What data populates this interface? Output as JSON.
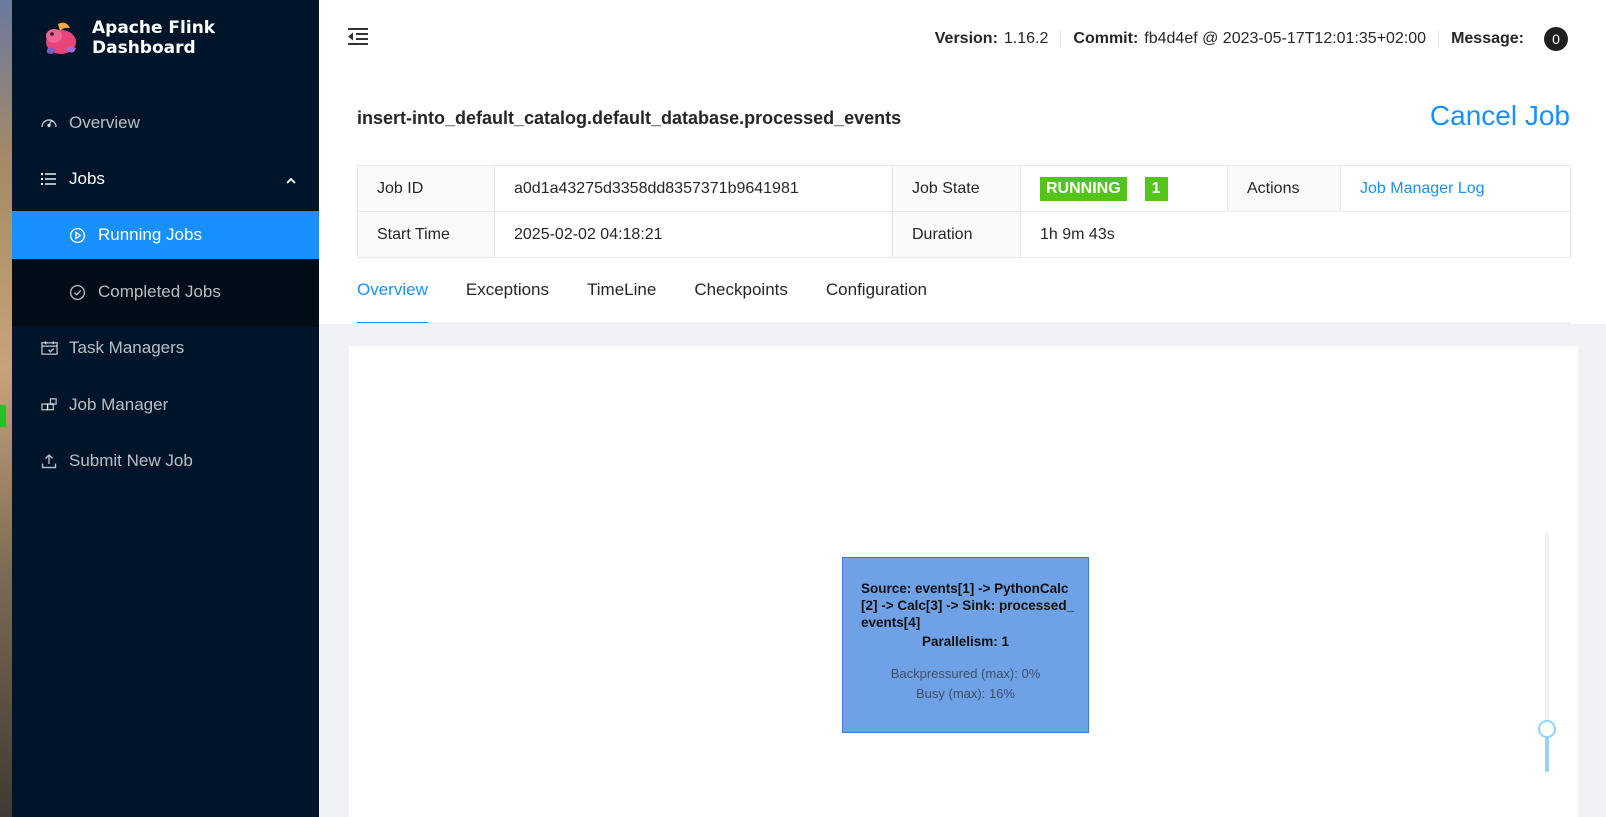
{
  "app": {
    "title": "Apache Flink Dashboard"
  },
  "sidebar": {
    "items": [
      {
        "label": "Overview",
        "icon": "dashboard-icon"
      },
      {
        "label": "Jobs",
        "icon": "list-icon"
      },
      {
        "label": "Running Jobs",
        "icon": "play-circle-icon"
      },
      {
        "label": "Completed Jobs",
        "icon": "check-circle-icon"
      },
      {
        "label": "Task Managers",
        "icon": "schedule-icon"
      },
      {
        "label": "Job Manager",
        "icon": "build-icon"
      },
      {
        "label": "Submit New Job",
        "icon": "upload-icon"
      }
    ]
  },
  "header": {
    "version_label": "Version:",
    "version": "1.16.2",
    "commit_label": "Commit:",
    "commit": "fb4d4ef @ 2023-05-17T12:01:35+02:00",
    "message_label": "Message:",
    "message_count": "0"
  },
  "job": {
    "name": "insert-into_default_catalog.default_database.processed_events",
    "cancel_label": "Cancel Job",
    "id_label": "Job ID",
    "id": "a0d1a43275d3358dd8357371b9641981",
    "state_label": "Job State",
    "state": "RUNNING",
    "state_count": "1",
    "actions_label": "Actions",
    "jm_log_label": "Job Manager Log",
    "start_label": "Start Time",
    "start": "2025-02-02 04:18:21",
    "duration_label": "Duration",
    "duration": "1h 9m 43s"
  },
  "tabs": [
    "Overview",
    "Exceptions",
    "TimeLine",
    "Checkpoints",
    "Configuration"
  ],
  "graph": {
    "node": {
      "name": "Source: events[1] -> PythonCalc[2] -> Calc[3] -> Sink: processed_events[4]",
      "parallelism": "Parallelism: 1",
      "backpressured": "Backpressured (max): 0%",
      "busy": "Busy (max): 16%"
    },
    "zoom_level": 0.2
  },
  "colors": {
    "accent": "#1890ff",
    "sidebar": "#001529",
    "running": "#52c41a",
    "node": "#6ea1e5"
  }
}
